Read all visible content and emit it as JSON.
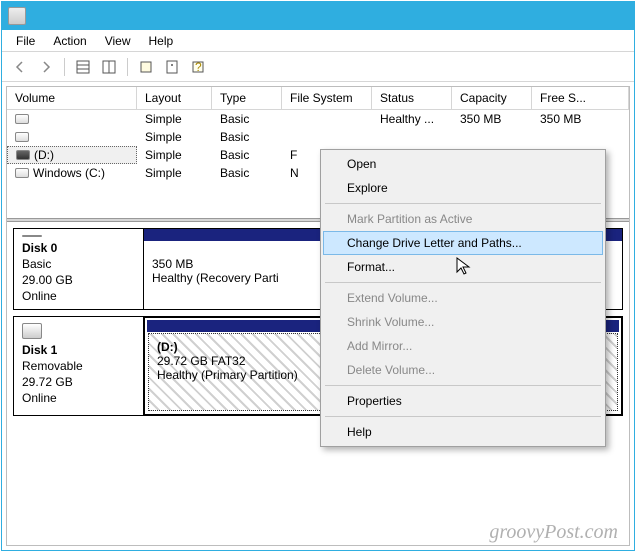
{
  "menubar": {
    "file": "File",
    "action": "Action",
    "view": "View",
    "help": "Help"
  },
  "columns": {
    "volume": "Volume",
    "layout": "Layout",
    "type": "Type",
    "fs": "File System",
    "status": "Status",
    "capacity": "Capacity",
    "free": "Free S..."
  },
  "rows": [
    {
      "volume": "",
      "layout": "Simple",
      "type": "Basic",
      "fs": "",
      "status": "Healthy ...",
      "capacity": "350 MB",
      "free": "350 MB"
    },
    {
      "volume": "",
      "layout": "Simple",
      "type": "Basic",
      "fs": "",
      "status": "",
      "capacity": "",
      "free": ""
    },
    {
      "volume": "(D:)",
      "layout": "Simple",
      "type": "Basic",
      "fs": "F",
      "status": "",
      "capacity": "",
      "free": ""
    },
    {
      "volume": "Windows (C:)",
      "layout": "Simple",
      "type": "Basic",
      "fs": "N",
      "status": "",
      "capacity": "",
      "free": ""
    }
  ],
  "disks": {
    "disk0": {
      "name": "Disk 0",
      "type": "Basic",
      "size": "29.00 GB",
      "status": "Online",
      "part": {
        "size": "350 MB",
        "status": "Healthy (Recovery Parti"
      }
    },
    "disk1": {
      "name": "Disk 1",
      "type": "Removable",
      "size": "29.72 GB",
      "status": "Online",
      "part": {
        "label": "(D:)",
        "size": "29.72 GB FAT32",
        "status": "Healthy (Primary Partition)"
      }
    }
  },
  "context_menu": {
    "open": "Open",
    "explore": "Explore",
    "mark_active": "Mark Partition as Active",
    "change_letter": "Change Drive Letter and Paths...",
    "format": "Format...",
    "extend": "Extend Volume...",
    "shrink": "Shrink Volume...",
    "add_mirror": "Add Mirror...",
    "delete": "Delete Volume...",
    "properties": "Properties",
    "help": "Help"
  },
  "watermark": "groovyPost.com"
}
